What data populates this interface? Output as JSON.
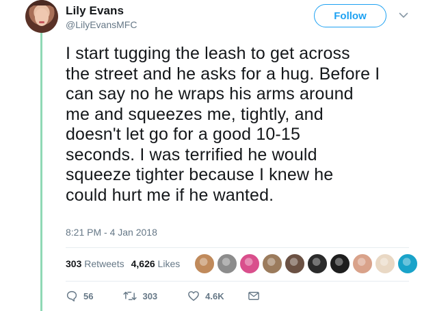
{
  "author": {
    "name": "Lily Evans",
    "handle": "@LilyEvansMFC"
  },
  "follow_label": "Follow",
  "tweet": {
    "text": "I start tugging the leash to get across\nthe street and he asks for a hug. Before I\ncan say no he wraps his arms around\nme and squeezes me, tightly, and\ndoesn't let go for a good 10-15\nseconds. I was terrified he would\nsqueeze tighter because I knew he\ncould hurt me if he wanted.",
    "timestamp": "8:21 PM - 4 Jan 2018"
  },
  "stats": {
    "retweets_count": "303",
    "retweets_label": "Retweets",
    "likes_count": "4,626",
    "likes_label": "Likes"
  },
  "liker_avatars": [
    {
      "color": "#c08a5b"
    },
    {
      "color": "#8c8c8c"
    },
    {
      "color": "#d94f8c"
    },
    {
      "color": "#9b7b5c"
    },
    {
      "color": "#6b5143"
    },
    {
      "color": "#2b2b2b"
    },
    {
      "color": "#1e1e1e"
    },
    {
      "color": "#d9a28a"
    },
    {
      "color": "#e9d8c4"
    },
    {
      "color": "#1aa3c9"
    }
  ],
  "actions": {
    "reply_count": "56",
    "retweet_count": "303",
    "like_count": "4.6K"
  },
  "colors": {
    "accent": "#1da1f2",
    "thread_line": "#8fd9b5",
    "muted": "#657786"
  }
}
